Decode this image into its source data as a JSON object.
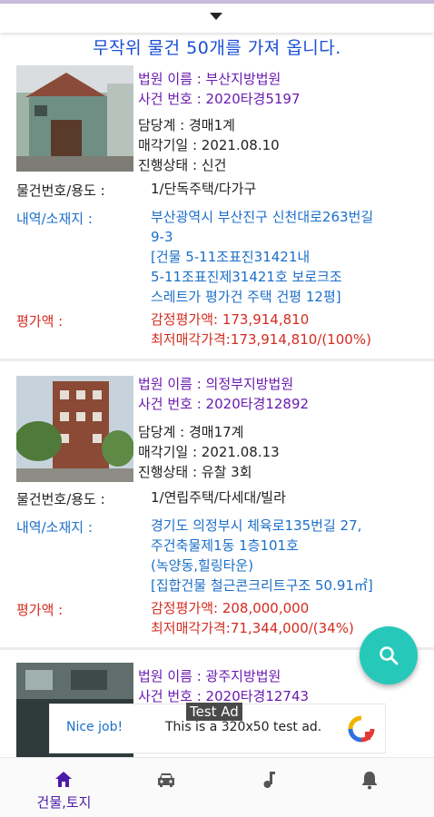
{
  "header": {
    "title": "무작위 물건 50개를 가져 옵니다."
  },
  "listings": [
    {
      "court": "법원 이름 : 부산지방법원",
      "case_no": "사건 번호 : 2020타경5197",
      "manager": "담당계 : 경매1계",
      "sale_date": "매각기일 : 2021.08.10",
      "status": "진행상태 : 신건",
      "item_label": "물건번호/용도 :",
      "item_value": "1/단독주택/다가구",
      "addr_label": "내역/소재지 :",
      "addr_lines": [
        "부산광역시 부산진구 신천대로263번길",
        "9-3",
        "[건물 5-11조표진31421내",
        "5-11조표진제31421호 보로크조",
        "스레트가 평가건 주택 건평 12평]"
      ],
      "price_label": "평가액 :",
      "appraisal": "감정평가액: 173,914,810",
      "min_price": "최저매각가격:173,914,810/(100%)"
    },
    {
      "court": "법원 이름 : 의정부지방법원",
      "case_no": "사건 번호 : 2020타경12892",
      "manager": "담당계 : 경매17계",
      "sale_date": "매각기일 : 2021.08.13",
      "status": "진행상태 : 유찰 3회",
      "item_label": "물건번호/용도 :",
      "item_value": "1/연립주택/다세대/빌라",
      "addr_label": "내역/소재지 :",
      "addr_lines": [
        "경기도 의정부시 체육로135번길 27,",
        "주건축물제1동 1층101호",
        "(녹양동,힐링타운)",
        "[집합건물 철근콘크리트구조 50.91㎡]"
      ],
      "price_label": "평가액 :",
      "appraisal": "감정평가액: 208,000,000",
      "min_price": "최저매각가격:71,344,000/(34%)"
    },
    {
      "court": "법원 이름 : 광주지방법원",
      "case_no": "사건 번호 : 2020타경12743"
    }
  ],
  "ad": {
    "label": "Test Ad",
    "nice": "Nice job!",
    "text": "This is a 320x50 test ad."
  },
  "bottom_nav": [
    {
      "label": "건물,토지",
      "icon": "home-icon",
      "active": true
    },
    {
      "label": "",
      "icon": "car-icon",
      "active": false
    },
    {
      "label": "",
      "icon": "music-note-icon",
      "active": false
    },
    {
      "label": "",
      "icon": "bell-icon",
      "active": false
    }
  ],
  "colors": {
    "title_blue": "#1a4fd6",
    "court_purple": "#6a1bb0",
    "label_blue": "#1c6fc8",
    "price_red": "#d42b20",
    "fab_teal": "#26c9b9",
    "nav_active": "#4b1aa8"
  }
}
